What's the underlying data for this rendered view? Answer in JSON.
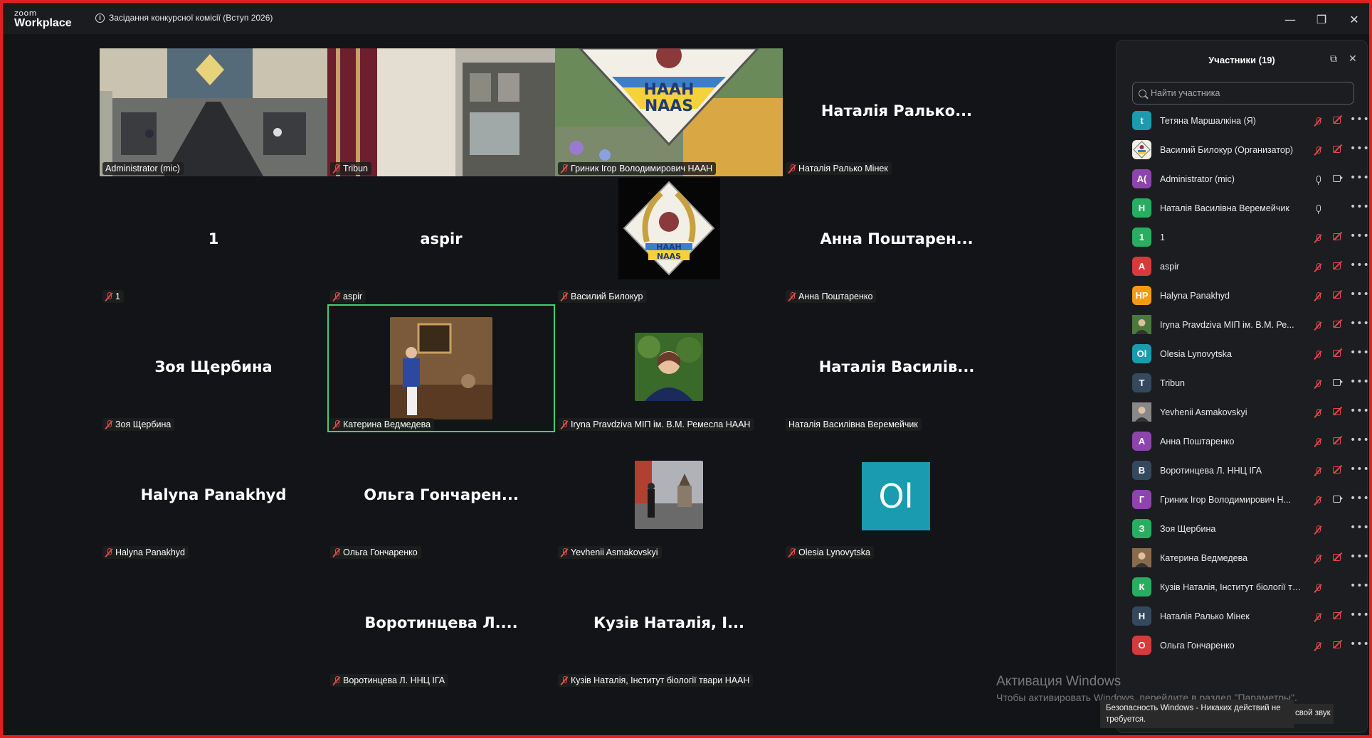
{
  "app": {
    "logo_top": "zoom",
    "logo_bottom": "Workplace",
    "meeting_title": "Засідання конкурсної комісії (Вступ 2026)"
  },
  "window": {
    "minimize": "—",
    "restore": "❐",
    "close": "✕"
  },
  "tiles": [
    {
      "big": "",
      "label": "Administrator (mic)",
      "muted": false,
      "kind": "room-video"
    },
    {
      "big": "",
      "label": "Tribun",
      "muted": true,
      "kind": "tribun-video"
    },
    {
      "big": "",
      "label": "Гриник Ігор Володимирович НААН",
      "muted": true,
      "kind": "naas-video"
    },
    {
      "big": "Наталія Ралько...",
      "label": "Наталія Ралько Мінек",
      "muted": true,
      "kind": "name"
    },
    {
      "big": "1",
      "label": "1",
      "muted": true,
      "kind": "name"
    },
    {
      "big": "aspir",
      "label": "aspir",
      "muted": true,
      "kind": "name"
    },
    {
      "big": "",
      "label": "Василий Билокур",
      "muted": true,
      "kind": "naas-logo"
    },
    {
      "big": "Анна  Поштарен...",
      "label": "Анна Поштаренко",
      "muted": true,
      "kind": "name"
    },
    {
      "big": "Зоя Щербина",
      "label": "Зоя Щербина",
      "muted": true,
      "kind": "name"
    },
    {
      "big": "",
      "label": "Катерина Ведмедева",
      "muted": true,
      "kind": "photo-kat",
      "active": true
    },
    {
      "big": "",
      "label": "Iryna Pravdziva МІП ім. В.М. Ремесла НААН",
      "muted": true,
      "kind": "photo-iryna"
    },
    {
      "big": "Наталія Василів...",
      "label": "Наталія Василівна Веремейчик",
      "muted": false,
      "kind": "name"
    },
    {
      "big": "Halyna Panakhyd",
      "label": "Halyna Panakhyd",
      "muted": true,
      "kind": "name"
    },
    {
      "big": "Ольга  Гончарен...",
      "label": "Ольга Гончаренко",
      "muted": true,
      "kind": "name"
    },
    {
      "big": "",
      "label": "Yevhenii Asmakovskyi",
      "muted": true,
      "kind": "photo-yev"
    },
    {
      "big": "",
      "label": "Olesia Lynovytska",
      "muted": true,
      "kind": "ol-avatar",
      "avatar_text": "Ol"
    },
    {
      "big": "",
      "label": "",
      "muted": false,
      "kind": "empty"
    },
    {
      "big": "Воротинцева  Л....",
      "label": "Воротинцева Л. ННЦ ІГА",
      "muted": true,
      "kind": "name"
    },
    {
      "big": "Кузів Наталія, І...",
      "label": "Кузів Наталія, Інститут біології твари НААН",
      "muted": true,
      "kind": "name"
    }
  ],
  "naas_logo": {
    "line1": "НААН",
    "line2": "NAAS"
  },
  "panel": {
    "title": "Участники (19)",
    "search_placeholder": "Найти участника",
    "participants": [
      {
        "initials": "t",
        "color": "#1a9bb0",
        "name": "Тетяна Маршалкіна (Я)",
        "mic": "off",
        "cam": "off"
      },
      {
        "initials": "",
        "color": "#e8d7a0",
        "name": "Василий Билокур (Организатор)",
        "mic": "off",
        "cam": "off",
        "img": "naas"
      },
      {
        "initials": "A(",
        "color": "#8e44ad",
        "name": "Administrator (mic)",
        "mic": "on",
        "cam": "on"
      },
      {
        "initials": "Н",
        "color": "#27ae60",
        "name": "Наталія Василівна Веремейчик",
        "mic": "on",
        "cam": "none"
      },
      {
        "initials": "1",
        "color": "#27ae60",
        "name": "1",
        "mic": "off",
        "cam": "off"
      },
      {
        "initials": "A",
        "color": "#d63a3a",
        "name": "aspir",
        "mic": "off",
        "cam": "off"
      },
      {
        "initials": "HP",
        "color": "#f39c12",
        "name": "Halyna Panakhyd",
        "mic": "off",
        "cam": "off"
      },
      {
        "initials": "",
        "color": "#4a7a3a",
        "name": "Iryna Pravdziva МІП ім. В.М. Ре...",
        "mic": "off",
        "cam": "off",
        "img": "photo"
      },
      {
        "initials": "Ol",
        "color": "#1a9bb0",
        "name": "Olesia Lynovytska",
        "mic": "off",
        "cam": "off"
      },
      {
        "initials": "T",
        "color": "#34495e",
        "name": "Tribun",
        "mic": "off",
        "cam": "on"
      },
      {
        "initials": "",
        "color": "#888",
        "name": "Yevhenii Asmakovskyi",
        "mic": "off",
        "cam": "off",
        "img": "photo2"
      },
      {
        "initials": "A",
        "color": "#8e44ad",
        "name": "Анна Поштаренко",
        "mic": "off",
        "cam": "off"
      },
      {
        "initials": "В",
        "color": "#34495e",
        "name": "Воротинцева Л. ННЦ ІГА",
        "mic": "off",
        "cam": "off"
      },
      {
        "initials": "Г",
        "color": "#8e44ad",
        "name": "Гриник Ігор Володимирович Н...",
        "mic": "off",
        "cam": "on"
      },
      {
        "initials": "З",
        "color": "#27ae60",
        "name": "Зоя Щербина",
        "mic": "off",
        "cam": "none"
      },
      {
        "initials": "",
        "color": "#8a6a4a",
        "name": "Катерина Ведмедева",
        "mic": "off",
        "cam": "off",
        "img": "photo3"
      },
      {
        "initials": "К",
        "color": "#27ae60",
        "name": "Кузів Наталія, Інститут біології твар...",
        "mic": "off",
        "cam": "none"
      },
      {
        "initials": "Н",
        "color": "#34495e",
        "name": "Наталія Ралько Мінек",
        "mic": "off",
        "cam": "off"
      },
      {
        "initials": "О",
        "color": "#d63a3a",
        "name": "Ольга Гончаренко",
        "mic": "off",
        "cam": "off"
      }
    ]
  },
  "watermark": {
    "line1": "Активация Windows",
    "line2": "Чтобы активировать Windows, перейдите в раздел \"Параметры\"."
  },
  "toast": {
    "text": "Безопасность Windows - Никаких действий не требуется.",
    "side": "свой звук"
  }
}
